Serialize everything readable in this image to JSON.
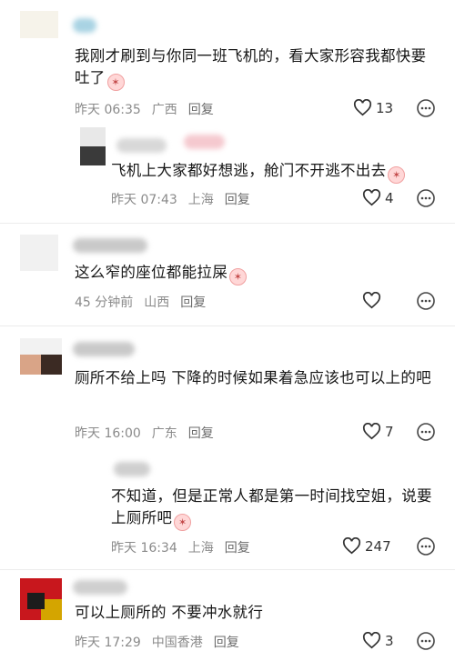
{
  "comments": [
    {
      "text": "我刚才刷到与你同一班飞机的，看大家形容我都快要吐了",
      "time": "昨天 06:35",
      "location": "广西",
      "reply": "回复",
      "likes": "13",
      "emoji": "😭"
    },
    {
      "text": "飞机上大家都好想逃，舱门不开逃不出去",
      "time": "昨天 07:43",
      "location": "上海",
      "reply": "回复",
      "likes": "4",
      "emoji": "😭"
    },
    {
      "text": "这么窄的座位都能拉屎",
      "time": "45 分钟前",
      "location": "山西",
      "reply": "回复",
      "likes": "",
      "emoji": "😭"
    },
    {
      "text": "厕所不给上吗 下降的时候如果着急应该也可以上的吧",
      "time": "昨天 16:00",
      "location": "广东",
      "reply": "回复",
      "likes": "7",
      "emoji": ""
    },
    {
      "text": "不知道，但是正常人都是第一时间找空姐，说要上厕所吧",
      "time": "昨天 16:34",
      "location": "上海",
      "reply": "回复",
      "likes": "247",
      "emoji": "😭"
    },
    {
      "text": "可以上厕所的 不要冲水就行",
      "time": "昨天 17:29",
      "location": "中国香港",
      "reply": "回复",
      "likes": "3",
      "emoji": ""
    }
  ],
  "icons": {
    "like": "heart-icon",
    "more": "more-options-icon",
    "emoji": "crying-face-icon"
  }
}
